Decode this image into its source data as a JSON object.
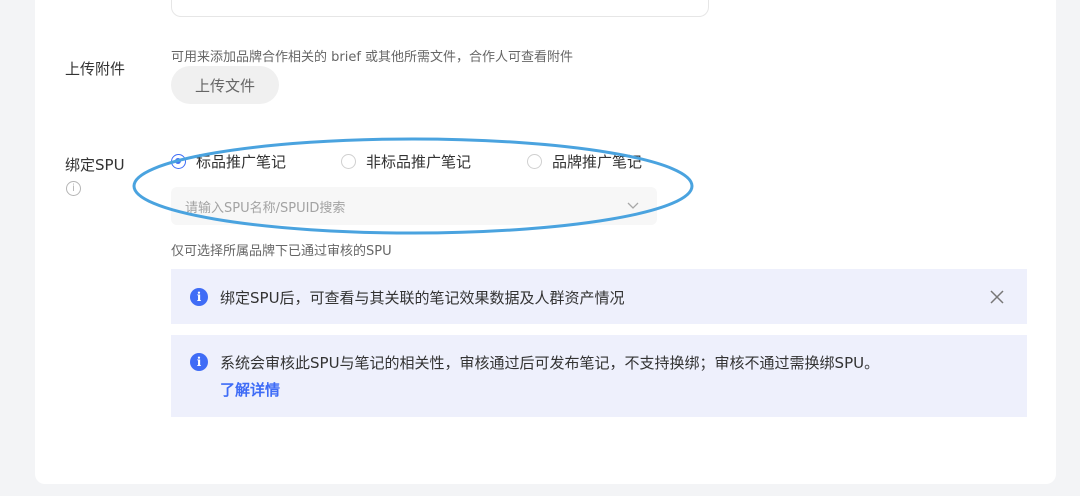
{
  "upload": {
    "label": "上传附件",
    "hint": "可用来添加品牌合作相关的 brief 或其他所需文件，合作人可查看附件",
    "button": "上传文件"
  },
  "spu": {
    "label": "绑定SPU",
    "info_icon": "ⓘ",
    "options": [
      "标品推广笔记",
      "非标品推广笔记",
      "品牌推广笔记"
    ],
    "selected_index": 0,
    "search_placeholder": "请输入SPU名称/SPUID搜索",
    "note": "仅可选择所属品牌下已通过审核的SPU"
  },
  "notices": [
    {
      "icon": "info-icon",
      "text": "绑定SPU后，可查看与其关联的笔记效果数据及人群资产情况",
      "closable": true
    },
    {
      "icon": "info-icon",
      "text": "系统会审核此SPU与笔记的相关性，审核通过后可发布笔记，不支持换绑；审核不通过需换绑SPU。",
      "link": "了解详情"
    }
  ],
  "colors": {
    "accent": "#3f6cf6",
    "annotation": "#4aa3df",
    "notice_bg": "#eef0fc"
  }
}
